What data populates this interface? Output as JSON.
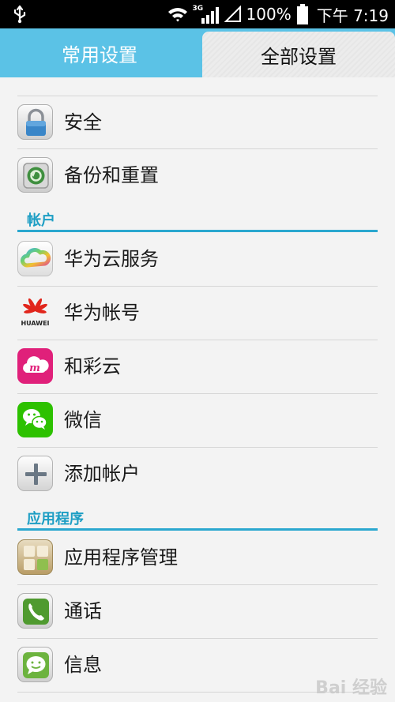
{
  "status_bar": {
    "network": "3G",
    "battery": "100%",
    "time": "下午 7:19"
  },
  "tabs": [
    {
      "label": "常用设置",
      "selected": false
    },
    {
      "label": "全部设置",
      "selected": true
    }
  ],
  "groups": [
    {
      "items": [
        {
          "label": "安全",
          "icon": "lock-icon"
        },
        {
          "label": "备份和重置",
          "icon": "backup-restore-icon"
        }
      ]
    },
    {
      "header": "帐户",
      "items": [
        {
          "label": "华为云服务",
          "icon": "cloud-service-icon"
        },
        {
          "label": "华为帐号",
          "icon": "huawei-logo-icon",
          "logo_text": "HUAWEI"
        },
        {
          "label": "和彩云",
          "icon": "caiyun-cloud-icon"
        },
        {
          "label": "微信",
          "icon": "wechat-icon"
        },
        {
          "label": "添加帐户",
          "icon": "add-account-icon"
        }
      ]
    },
    {
      "header": "应用程序",
      "items": [
        {
          "label": "应用程序管理",
          "icon": "app-manager-icon"
        },
        {
          "label": "通话",
          "icon": "phone-icon"
        },
        {
          "label": "信息",
          "icon": "message-icon"
        }
      ]
    }
  ],
  "watermark": "Bai 经验",
  "colors": {
    "tab_bar": "#5bc2e6",
    "section_accent": "#2aa7cf",
    "status_bar": "#000000"
  }
}
